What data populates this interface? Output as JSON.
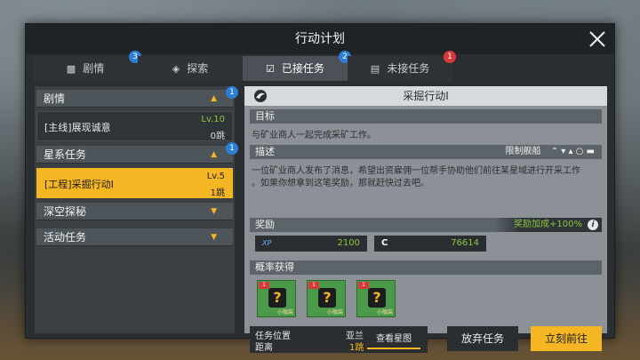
{
  "window": {
    "title": "行动计划"
  },
  "tabs": [
    {
      "label": "剧情",
      "icon": "book-icon",
      "badge": "3"
    },
    {
      "label": "探索",
      "icon": "explore-icon",
      "badge": ""
    },
    {
      "label": "已接任务",
      "icon": "clipboard-check-icon",
      "badge": "2"
    },
    {
      "label": "未接任务",
      "icon": "clipboard-icon",
      "badge": "1"
    }
  ],
  "left": {
    "categories": [
      {
        "label": "剧情",
        "badge": "1"
      },
      {
        "label": "星系任务",
        "badge": "1"
      },
      {
        "label": "深空探秘"
      },
      {
        "label": "活动任务"
      }
    ],
    "quests": [
      {
        "name": "[主线]展现诚意",
        "level": "Lv.10",
        "jumps": "0跳"
      },
      {
        "name": "[工程]采掘行动I",
        "level": "Lv.5",
        "jumps": "1跳"
      }
    ]
  },
  "detail": {
    "title": "采掘行动I",
    "target_label": "目标",
    "target_text": "与矿业商人一起完成采矿工作。",
    "desc_label": "描述",
    "restrict_label": "限制舰船",
    "desc_text_1": "一位矿业商人发布了消息，希望出资雇佣一位帮手协助他们前往某星域进行开采工作",
    "desc_text_2": "。如果你想拿到这笔奖励，那就赶快过去吧。",
    "reward_label": "奖励",
    "reward_bonus": "奖励加成+100%",
    "rewards": [
      {
        "icon": "XP",
        "value": "2100"
      },
      {
        "icon": "C",
        "value": "76614"
      }
    ],
    "drop_label": "概率获得",
    "items": [
      {
        "tag": "1",
        "small": "小舰装"
      },
      {
        "tag": "1",
        "small": "小舰装"
      },
      {
        "tag": "1",
        "small": "小舰装"
      }
    ],
    "location_label": "任务位置",
    "location_value": "亚兰",
    "distance_label": "距离",
    "distance_value": "1跳",
    "starmap_button": "查看星图",
    "abandon_button": "放弃任务",
    "go_button": "立刻前往"
  },
  "colors": {
    "accent": "#f5b623",
    "badge_blue": "#2b7fd6",
    "badge_red": "#d83a3a",
    "green": "#8cc63f"
  }
}
